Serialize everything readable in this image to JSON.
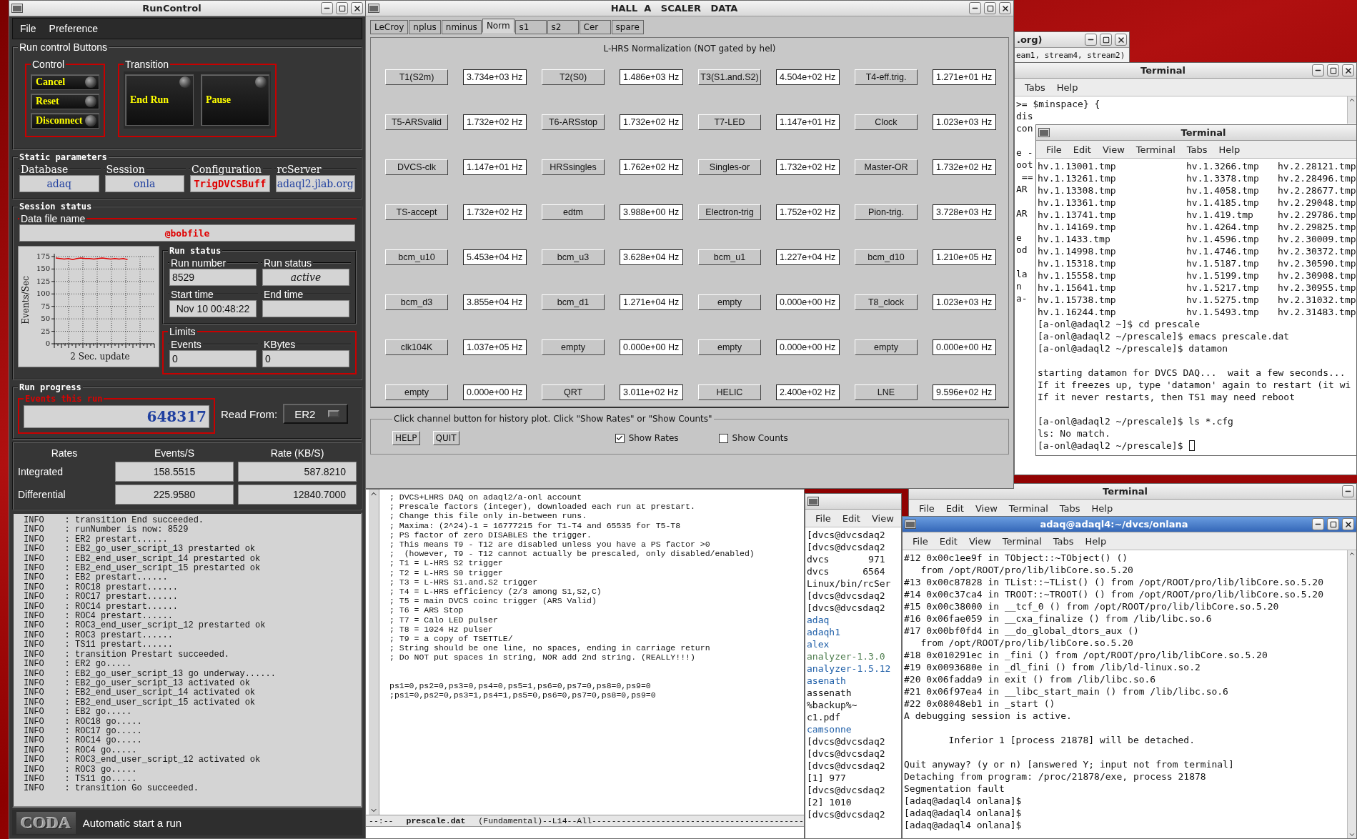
{
  "run_control": {
    "title": "RunControl",
    "menu": [
      "File",
      "Preference"
    ],
    "buttons_group": "Run control Buttons",
    "control": {
      "title": "Control",
      "buttons": [
        "Cancel",
        "Reset",
        "Disconnect"
      ]
    },
    "transition": {
      "title": "Transition",
      "buttons": [
        "End Run",
        "Pause"
      ]
    },
    "static_parameters": {
      "title": "Static parameters",
      "fields": [
        {
          "label": "Database",
          "value": "adaq",
          "kind": "normal"
        },
        {
          "label": "Session",
          "value": "onla",
          "kind": "normal"
        },
        {
          "label": "Configuration",
          "value": "TrigDVCSBuff",
          "kind": "highlight"
        },
        {
          "label": "rcServer",
          "value": "adaql2.jlab.org",
          "kind": "normal"
        }
      ]
    },
    "session_status": {
      "title": "Session status",
      "data_file_label": "Data file name",
      "data_file": "@bobfile"
    },
    "chart_data": {
      "type": "line",
      "grid": true,
      "xlabel": "2 Sec. update",
      "ylabel": "Events/Sec",
      "ylim": [
        0,
        175
      ],
      "yticks": [
        0,
        25,
        50,
        75,
        100,
        125,
        150,
        175
      ],
      "series": [
        {
          "color": "#e00000",
          "values": [
            172,
            171,
            170,
            171,
            169,
            171,
            172,
            171,
            171,
            170,
            171,
            172,
            171,
            170,
            171,
            170,
            171,
            169,
            null,
            null,
            null,
            null,
            null,
            null
          ]
        }
      ]
    },
    "run_status": {
      "title": "Run status",
      "run_number": {
        "label": "Run number",
        "value": "8529"
      },
      "status": {
        "label": "Run status",
        "value": "active"
      },
      "start_time": {
        "label": "Start time",
        "value": "Nov 10 00:48:22"
      },
      "end_time": {
        "label": "End time"
      }
    },
    "limits": {
      "title": "Limits",
      "events": {
        "label": "Events",
        "value": "0"
      },
      "kbytes": {
        "label": "KBytes",
        "value": "0"
      }
    },
    "run_progress": {
      "title": "Run progress",
      "events_label": "Events this run",
      "events": "648317",
      "read_from_label": "Read From:",
      "read_from": "ER2"
    },
    "rates": {
      "columns": [
        "Rates",
        "Events/S",
        "Rate (KB/S)"
      ],
      "rows": [
        {
          "label": "Integrated",
          "events": "158.5515",
          "rate": "587.8210"
        },
        {
          "label": "Differential",
          "events": "225.9580",
          "rate": "12840.7000"
        }
      ]
    },
    "log": [
      "INFO    : transition End succeeded.",
      "INFO    : runNumber is now: 8529",
      "INFO    : ER2 prestart......",
      "INFO    : EB2_go_user_script_13 prestarted ok",
      "INFO    : EB2_end_user_script_14 prestarted ok",
      "INFO    : EB2_end_user_script_15 prestarted ok",
      "INFO    : EB2 prestart......",
      "INFO    : ROC18 prestart......",
      "INFO    : ROC17 prestart......",
      "INFO    : ROC14 prestart......",
      "INFO    : ROC4 prestart......",
      "INFO    : ROC3_end_user_script_12 prestarted ok",
      "INFO    : ROC3 prestart......",
      "INFO    : TS11 prestart......",
      "INFO    : transition Prestart succeeded.",
      "INFO    : ER2 go.....",
      "INFO    : EB2_go_user_script_13 go underway......",
      "INFO    : EB2_go_user_script_13 activated ok",
      "INFO    : EB2_end_user_script_14 activated ok",
      "INFO    : EB2_end_user_script_15 activated ok",
      "INFO    : EB2 go.....",
      "INFO    : ROC18 go.....",
      "INFO    : ROC17 go.....",
      "INFO    : ROC14 go.....",
      "INFO    : ROC4 go.....",
      "INFO    : ROC3_end_user_script_12 activated ok",
      "INFO    : ROC3 go.....",
      "INFO    : TS11 go.....",
      "INFO    : transition Go succeeded."
    ],
    "logo": "CODA",
    "status": "Automatic start a run"
  },
  "scaler": {
    "title": "HALL  A   SCALER   DATA",
    "tabs": [
      {
        "label": "LeCroy",
        "selected": false
      },
      {
        "label": "nplus",
        "selected": false
      },
      {
        "label": "nminus",
        "selected": false
      },
      {
        "label": "Norm",
        "selected": true
      },
      {
        "label": "s1",
        "selected": false
      },
      {
        "label": "s2",
        "selected": false
      },
      {
        "label": "Cer",
        "selected": false
      },
      {
        "label": "spare",
        "selected": false
      }
    ],
    "heading": "L-HRS Normalization (NOT gated by hel)",
    "channels": [
      {
        "label": "T1(S2m)",
        "value": "3.734e+03 Hz"
      },
      {
        "label": "T2(S0)",
        "value": "1.486e+03 Hz"
      },
      {
        "label": "T3(S1.and.S2)",
        "value": "4.504e+02 Hz"
      },
      {
        "label": "T4-eff.trig.",
        "value": "1.271e+01 Hz"
      },
      {
        "label": "T5-ARSvalid",
        "value": "1.732e+02 Hz"
      },
      {
        "label": "T6-ARSstop",
        "value": "1.732e+02 Hz"
      },
      {
        "label": "T7-LED",
        "value": "1.147e+01 Hz"
      },
      {
        "label": "Clock",
        "value": "1.023e+03 Hz"
      },
      {
        "label": "DVCS-clk",
        "value": "1.147e+01 Hz"
      },
      {
        "label": "HRSsingles",
        "value": "1.762e+02 Hz"
      },
      {
        "label": "Singles-or",
        "value": "1.732e+02 Hz"
      },
      {
        "label": "Master-OR",
        "value": "1.732e+02 Hz"
      },
      {
        "label": "TS-accept",
        "value": "1.732e+02 Hz"
      },
      {
        "label": "edtm",
        "value": "3.988e+00 Hz"
      },
      {
        "label": "Electron-trig",
        "value": "1.752e+02 Hz"
      },
      {
        "label": "Pion-trig.",
        "value": "3.728e+03 Hz"
      },
      {
        "label": "bcm_u10",
        "value": "5.453e+04 Hz"
      },
      {
        "label": "bcm_u3",
        "value": "3.628e+04 Hz"
      },
      {
        "label": "bcm_u1",
        "value": "1.227e+04 Hz"
      },
      {
        "label": "bcm_d10",
        "value": "1.210e+05 Hz"
      },
      {
        "label": "bcm_d3",
        "value": "3.855e+04 Hz"
      },
      {
        "label": "bcm_d1",
        "value": "1.271e+04 Hz"
      },
      {
        "label": "empty",
        "value": "0.000e+00 Hz"
      },
      {
        "label": "T8_clock",
        "value": "1.023e+03 Hz"
      },
      {
        "label": "clk104K",
        "value": "1.037e+05 Hz"
      },
      {
        "label": "empty",
        "value": "0.000e+00 Hz"
      },
      {
        "label": "empty",
        "value": "0.000e+00 Hz"
      },
      {
        "label": "empty",
        "value": "0.000e+00 Hz"
      },
      {
        "label": "empty",
        "value": "0.000e+00 Hz"
      },
      {
        "label": "QRT",
        "value": "3.011e+02 Hz"
      },
      {
        "label": "HELIC",
        "value": "2.400e+02 Hz"
      },
      {
        "label": "LNE",
        "value": "9.596e+02 Hz"
      }
    ],
    "footer": {
      "title": "Click channel button for history plot.  Click \"Show Rates\" or \"Show Counts\"",
      "buttons": [
        "HELP",
        "QUIT"
      ],
      "options": [
        {
          "label": "Show Rates",
          "checked": true
        },
        {
          "label": "Show Counts",
          "checked": false
        }
      ]
    }
  },
  "editor": {
    "lines": [
      "; DVCS+LHRS DAQ on adaql2/a-onl account",
      "; Prescale factors (integer), downloaded each run at prestart.",
      "; Change this file only in-between runs.",
      "; Maxima: (2^24)-1 = 16777215 for T1-T4 and 65535 for T5-T8",
      "; PS factor of zero DISABLES the trigger.",
      "; This means T9 - T12 are disabled unless you have a PS factor >0",
      ";  (however, T9 - T12 cannot actually be prescaled, only disabled/enabled)",
      "; T1 = L-HRS S2 trigger",
      "; T2 = L-HRS S0 trigger",
      "; T3 = L-HRS S1.and.S2 trigger",
      "; T4 = L-HRS efficiency (2/3 among S1,S2,C)",
      "; T5 = main DVCS coinc trigger (ARS Valid)",
      "; T6 = ARS Stop",
      "; T7 = Calo LED pulser",
      "; T8 = 1024 Hz pulser",
      "; T9 = a copy of TSETTLE/",
      "; String should be one line, no spaces, ending in carriage return",
      "; Do NOT put spaces in string, NOR add 2nd string. (REALLY!!!)"
    ],
    "settings": [
      "ps1=0,ps2=0,ps3=0,ps4=0,ps5=1,ps6=0,ps7=0,ps8=0,ps9=0",
      ";ps1=0,ps2=0,ps3=1,ps4=1,ps5=0,ps6=0,ps7=0,ps8=0,ps9=0"
    ],
    "modeline": {
      "state": "--:--",
      "buffer": "prescale.dat",
      "info": "(Fundamental)--L14--All-------------------------------------------"
    }
  },
  "org_window": {
    "title": ".org)",
    "line": "eam1, stream4, stream2)"
  },
  "terminal_back": {
    "title": "Terminal",
    "menu": [
      "Tabs",
      "Help"
    ],
    "paragraphs": [
      [
        ">= $minspace} {",
        "dis",
        "con"
      ],
      [
        "e -",
        "oot",
        " ==",
        "AR"
      ],
      [
        "AR"
      ],
      [
        "e",
        "od"
      ],
      [
        "la",
        "n",
        "a-"
      ]
    ]
  },
  "terminal_hv": {
    "title": "Terminal",
    "menu": [
      "File",
      "Edit",
      "View",
      "Terminal",
      "Tabs",
      "Help"
    ],
    "listing": [
      [
        "hv.1.13001.tmp",
        "hv.1.3266.tmp",
        "hv.2.28121.tmp"
      ],
      [
        "hv.1.13261.tmp",
        "hv.1.3378.tmp",
        "hv.2.28496.tmp"
      ],
      [
        "hv.1.13308.tmp",
        "hv.1.4058.tmp",
        "hv.2.28677.tmp"
      ],
      [
        "hv.1.13361.tmp",
        "hv.1.4185.tmp",
        "hv.2.29048.tmp"
      ],
      [
        "hv.1.13741.tmp",
        "hv.1.419.tmp",
        "hv.2.29786.tmp"
      ],
      [
        "hv.1.14169.tmp",
        "hv.1.4264.tmp",
        "hv.2.29825.tmp"
      ],
      [
        "hv.1.1433.tmp",
        "hv.1.4596.tmp",
        "hv.2.30009.tmp"
      ],
      [
        "hv.1.14998.tmp",
        "hv.1.4746.tmp",
        "hv.2.30372.tmp"
      ],
      [
        "hv.1.15318.tmp",
        "hv.1.5187.tmp",
        "hv.2.30590.tmp"
      ],
      [
        "hv.1.15558.tmp",
        "hv.1.5199.tmp",
        "hv.2.30908.tmp"
      ],
      [
        "hv.1.15641.tmp",
        "hv.1.5217.tmp",
        "hv.2.30955.tmp"
      ],
      [
        "hv.1.15738.tmp",
        "hv.1.5275.tmp",
        "hv.2.31032.tmp"
      ],
      [
        "hv.1.16244.tmp",
        "hv.1.5493.tmp",
        "hv.2.31483.tmp"
      ]
    ],
    "paragraphs": [
      [
        "[a-onl@adaql2 ~]$ cd prescale",
        "[a-onl@adaql2 ~/prescale]$ emacs prescale.dat",
        "[a-onl@adaql2 ~/prescale]$ datamon"
      ],
      [
        "starting datamon for DVCS DAQ...  wait a few seconds...",
        "If it freezes up, type 'datamon' again to restart (it wi",
        "If it never restarts, then TS1 may need reboot"
      ],
      [
        "[a-onl@adaql2 ~/prescale]$ ls *.cfg",
        "ls: No match.",
        "[a-onl@adaql2 ~/prescale]$"
      ]
    ],
    "cursor": true
  },
  "terminal_bottom": {
    "title": "Terminal",
    "menu": [
      "File",
      "Edit",
      "View",
      "Terminal",
      "Tabs",
      "Help"
    ]
  },
  "terminal_dvcs": {
    "menu": [
      "File",
      "Edit",
      "View"
    ],
    "lines": [
      {
        "text": "[dvcs@dvcsdaq2",
        "color": "#111111"
      },
      {
        "text": "[dvcs@dvcsdaq2",
        "color": "#111111"
      },
      {
        "text": "dvcs       971",
        "color": "#111111"
      },
      {
        "text": "dvcs      6564",
        "color": "#111111"
      },
      {
        "text": "Linux/bin/rcSer",
        "color": "#111111"
      },
      {
        "text": "[dvcs@dvcsdaq2",
        "color": "#111111"
      },
      {
        "text": "[dvcs@dvcsdaq2",
        "color": "#111111"
      },
      {
        "text": "adaq",
        "color": "#1f5fa8"
      },
      {
        "text": "adaqh1",
        "color": "#1f5fa8"
      },
      {
        "text": "alex",
        "color": "#1f5fa8"
      },
      {
        "text": "analyzer-1.3.0",
        "color": "#4e7d4e"
      },
      {
        "text": "analyzer-1.5.12",
        "color": "#1f5fa8"
      },
      {
        "text": "asenath",
        "color": "#1f5fa8"
      },
      {
        "text": "assenath",
        "color": "#111111"
      },
      {
        "text": "%backup%~",
        "color": "#111111"
      },
      {
        "text": "c1.pdf",
        "color": "#111111"
      },
      {
        "text": "camsonne",
        "color": "#1f5fa8"
      },
      {
        "text": "[dvcs@dvcsdaq2",
        "color": "#111111"
      },
      {
        "text": "[dvcs@dvcsdaq2",
        "color": "#111111"
      },
      {
        "text": "[dvcs@dvcsdaq2",
        "color": "#111111"
      },
      {
        "text": "[1] 977",
        "color": "#111111"
      },
      {
        "text": "[dvcs@dvcsdaq2",
        "color": "#111111"
      },
      {
        "text": "[2] 1010",
        "color": "#111111"
      },
      {
        "text": "[dvcs@dvcsdaq2",
        "color": "#111111"
      }
    ]
  },
  "terminal_adaq": {
    "title": "adaq@adaql4:~/dvcs/onlana",
    "active": true,
    "menu": [
      "File",
      "Edit",
      "View",
      "Terminal",
      "Tabs",
      "Help"
    ],
    "paragraphs": [
      [
        "#12 0x00c1ee9f in TObject::~TObject() ()",
        "   from /opt/ROOT/pro/lib/libCore.so.5.20",
        "#13 0x00c87828 in TList::~TList() () from /opt/ROOT/pro/lib/libCore.so.5.20",
        "#14 0x00c37ca4 in TROOT::~TROOT() () from /opt/ROOT/pro/lib/libCore.so.5.20",
        "#15 0x00c38000 in __tcf_0 () from /opt/ROOT/pro/lib/libCore.so.5.20",
        "#16 0x06fae059 in __cxa_finalize () from /lib/libc.so.6",
        "#17 0x00bf0fd4 in __do_global_dtors_aux ()",
        "   from /opt/ROOT/pro/lib/libCore.so.5.20",
        "#18 0x010291ec in _fini () from /opt/ROOT/pro/lib/libCore.so.5.20",
        "#19 0x0093680e in _dl_fini () from /lib/ld-linux.so.2",
        "#20 0x06fadda9 in exit () from /lib/libc.so.6",
        "#21 0x06f97ea4 in __libc_start_main () from /lib/libc.so.6",
        "#22 0x08048eb1 in _start ()",
        "A debugging session is active."
      ],
      [
        "        Inferior 1 [process 21878] will be detached."
      ],
      [
        "Quit anyway? (y or n) [answered Y; input not from terminal]",
        "Detaching from program: /proc/21878/exe, process 21878",
        "Segmentation fault",
        "[adaq@adaql4 onlana]$",
        "[adaq@adaql4 onlana]$",
        "[adaq@adaql4 onlana]$"
      ]
    ]
  }
}
